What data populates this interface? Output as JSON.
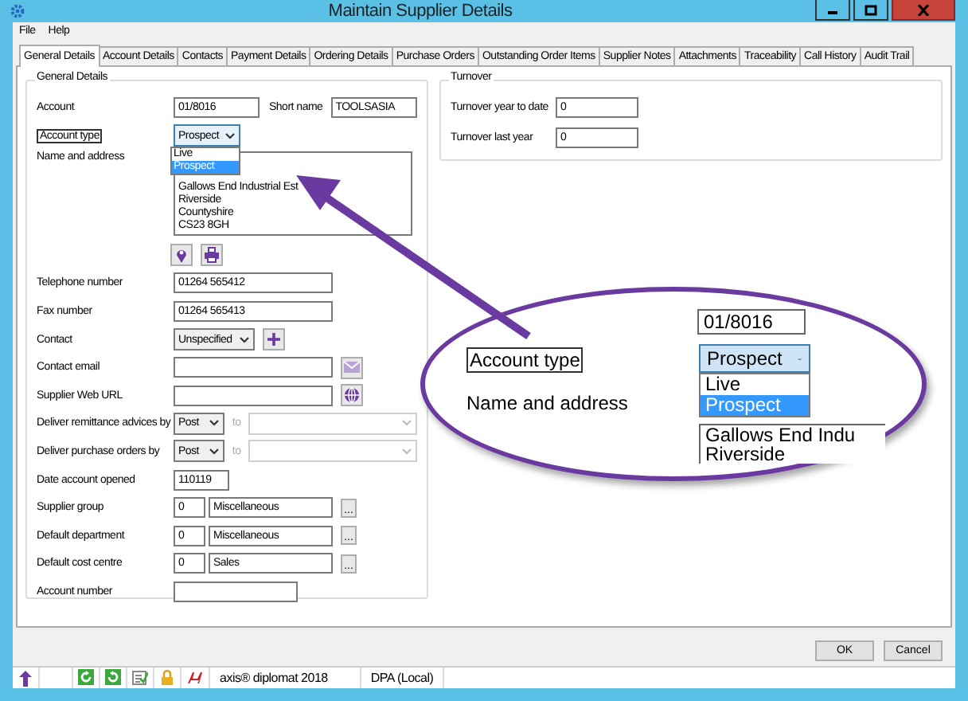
{
  "window": {
    "title": "Maintain Supplier Details"
  },
  "menu": [
    "File",
    "Help"
  ],
  "tabs": [
    {
      "label": "General Details",
      "selected": true
    },
    {
      "label": "Account Details",
      "selected": false
    },
    {
      "label": "Contacts",
      "selected": false
    },
    {
      "label": "Payment Details",
      "selected": false
    },
    {
      "label": "Ordering Details",
      "selected": false
    },
    {
      "label": "Purchase Orders",
      "selected": false
    },
    {
      "label": "Outstanding Order Items",
      "selected": false
    },
    {
      "label": "Supplier Notes",
      "selected": false
    },
    {
      "label": "Attachments",
      "selected": false
    },
    {
      "label": "Traceability",
      "selected": false
    },
    {
      "label": "Call History",
      "selected": false
    },
    {
      "label": "Audit Trail",
      "selected": false
    }
  ],
  "general_details": {
    "title": "General Details",
    "rows": [
      {
        "kind": "account",
        "label": "Account",
        "value": "01/8016",
        "extra_label": "Short name",
        "extra_value": "TOOLSASIA"
      },
      {
        "kind": "dropdown",
        "label": "Account type",
        "value": "Prospect",
        "expanded": true,
        "options": [
          {
            "label": "Live",
            "selected": false
          },
          {
            "label": "Prospect",
            "selected": true
          }
        ]
      },
      {
        "kind": "address",
        "label": "Name and address",
        "lines": [
          "Gallows End Industrial Est",
          "Riverside",
          "Countyshire",
          "CS23 8GH"
        ]
      },
      {
        "kind": "text",
        "label": "Telephone number",
        "value": "01264 565412"
      },
      {
        "kind": "text",
        "label": "Fax number",
        "value": "01264 565413"
      },
      {
        "kind": "contact",
        "label": "Contact",
        "value": "Unspecified"
      },
      {
        "kind": "email",
        "label": "Contact email"
      },
      {
        "kind": "web",
        "label": "Supplier Web URL"
      },
      {
        "kind": "delivery",
        "label": "Deliver remittance advices by",
        "value": "Post",
        "to_label": "to"
      },
      {
        "kind": "delivery",
        "label": "Deliver purchase orders by",
        "value": "Post",
        "to_label": "to"
      },
      {
        "kind": "short",
        "label": "Date account opened",
        "value": "110119"
      },
      {
        "kind": "lookup",
        "label": "Supplier group",
        "code": "0",
        "name": "Miscellaneous",
        "browse": "..."
      },
      {
        "kind": "lookup",
        "label": "Default department",
        "code": "0",
        "name": "Miscellaneous",
        "browse": "..."
      },
      {
        "kind": "lookup",
        "label": "Default cost centre",
        "code": "0",
        "name": "Sales",
        "browse": "..."
      },
      {
        "kind": "text",
        "label": "Account number"
      }
    ]
  },
  "turnover": {
    "title": "Turnover",
    "rows": [
      {
        "label": "Turnover year to date",
        "value": "0"
      },
      {
        "label": "Turnover last year",
        "value": "0"
      }
    ]
  },
  "buttons": [
    {
      "label": "OK"
    },
    {
      "label": "Cancel"
    }
  ],
  "status_bar": {
    "product": "axis® diplomat 2018",
    "location": "DPA (Local)"
  },
  "callout": {
    "field_value": "01/8016",
    "label": "Account type",
    "value": "Prospect",
    "options": [
      {
        "label": "Live",
        "selected": false
      },
      {
        "label": "Prospect",
        "selected": true
      }
    ],
    "label_2": "Name and address",
    "address_lines": [
      "Gallows End Indu",
      "Riverside"
    ]
  }
}
